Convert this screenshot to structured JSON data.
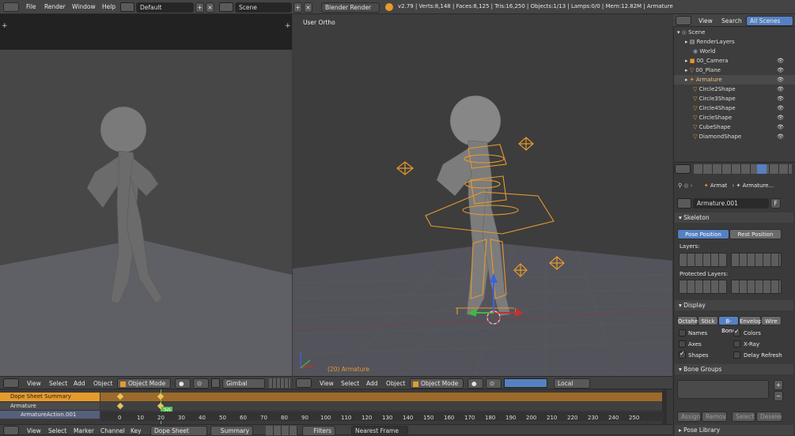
{
  "topbar": {
    "menu": [
      "File",
      "Render",
      "Window",
      "Help"
    ],
    "layout": "Default",
    "scene": "Scene",
    "engine": "Blender Render",
    "stats": "v2.79 | Verts:8,148 | Faces:8,125 | Tris:16,250 | Objects:1/13 | Lamps:0/0 | Mem:12.82M | Armature"
  },
  "viewport_left": {
    "header": {
      "menu": [
        "View",
        "Select",
        "Add",
        "Object"
      ],
      "mode": "Object Mode",
      "orientation": "Gimbal"
    }
  },
  "viewport_right": {
    "label": "User Ortho",
    "object_label": "(20) Armature",
    "header": {
      "menu": [
        "View",
        "Select",
        "Add",
        "Object"
      ],
      "mode": "Object Mode",
      "orientation": "Local"
    }
  },
  "outliner": {
    "menu": [
      "View",
      "Search"
    ],
    "filter": "All Scenes",
    "items": [
      {
        "name": "Scene",
        "indent": 0
      },
      {
        "name": "RenderLayers",
        "indent": 1
      },
      {
        "name": "World",
        "indent": 1
      },
      {
        "name": "00_Camera",
        "indent": 1
      },
      {
        "name": "00_Plane",
        "indent": 1
      },
      {
        "name": "Armature",
        "indent": 1
      },
      {
        "name": "Circle2Shape",
        "indent": 1
      },
      {
        "name": "Circle3Shape",
        "indent": 1
      },
      {
        "name": "Circle4Shape",
        "indent": 1
      },
      {
        "name": "CircleShape",
        "indent": 1
      },
      {
        "name": "CubeShape",
        "indent": 1
      },
      {
        "name": "DiamondShape",
        "indent": 1
      }
    ]
  },
  "properties": {
    "breadcrumb_1": "Armat",
    "breadcrumb_2": "Armature...",
    "data_name": "Armature.001",
    "fake_user": "F",
    "skeleton": {
      "title": "Skeleton",
      "pose": "Pose Position",
      "rest": "Rest Position",
      "layers": "Layers:",
      "protected": "Protected Layers:"
    },
    "display": {
      "title": "Display",
      "tabs": [
        "Octahe",
        "Stick",
        "B-Bone",
        "Envelop",
        "Wire"
      ],
      "active_tab": "B-Bone",
      "options": [
        {
          "label": "Names",
          "checked": false
        },
        {
          "label": "Colors",
          "checked": true
        },
        {
          "label": "Axes",
          "checked": false
        },
        {
          "label": "X-Ray",
          "checked": false
        },
        {
          "label": "Shapes",
          "checked": true
        },
        {
          "label": "Delay Refresh",
          "checked": false
        }
      ]
    },
    "bone_groups": {
      "title": "Bone Groups",
      "buttons": [
        "Assign",
        "Remove",
        "Select",
        "Deselect"
      ]
    },
    "pose_library": "Pose Library"
  },
  "dopesheet": {
    "channels": [
      "Dope Sheet Summary",
      "Armature",
      "ArmatureAction.001"
    ],
    "current_frame": "20",
    "ticks": [
      "0",
      "10",
      "20",
      "30",
      "40",
      "50",
      "60",
      "70",
      "80",
      "90",
      "100",
      "110",
      "120",
      "130",
      "140",
      "150",
      "160",
      "170",
      "180",
      "190",
      "200",
      "210",
      "220",
      "230",
      "240",
      "250"
    ],
    "header": {
      "menu": [
        "View",
        "Select",
        "Marker",
        "Channel",
        "Key"
      ],
      "mode": "Dope Sheet",
      "summary": "Summary",
      "filters": "Filters",
      "snap": "Nearest Frame"
    }
  },
  "colors": {
    "accent": "#e69a2c",
    "select_blue": "#5680c2"
  }
}
